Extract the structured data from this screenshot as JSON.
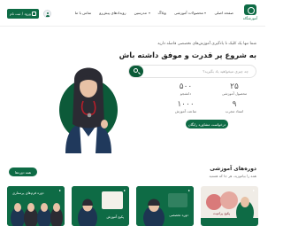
{
  "header": {
    "logo_text": "آموزشگاه",
    "nav": [
      {
        "label": "صفحه اصلی",
        "dropdown": false
      },
      {
        "label": "محصولات آموزشی",
        "dropdown": true
      },
      {
        "label": "وبلاگ",
        "dropdown": false
      },
      {
        "label": "مدرسین",
        "dropdown": true
      },
      {
        "label": "رویدادهای پیش‌رو",
        "dropdown": false
      },
      {
        "label": "تماس با ما",
        "dropdown": false
      }
    ],
    "login_label": "ورود / ثبت نام"
  },
  "hero": {
    "small_text": "شما تنها یک کلیک تا یادگیری آموزش‌های تخصصی فاصله دارید",
    "title": "به شروع پر قدرت و موفق داشته باش",
    "search_placeholder": "چه چیزی میخواهید یاد بگیرید؟",
    "stats": [
      {
        "number": "۲۵",
        "label": "محصول آموزشی"
      },
      {
        "number": "۵۰۰",
        "label": "دانشجو"
      },
      {
        "number": "۹",
        "label": "استاد مجرب"
      },
      {
        "number": "۱۰۰۰",
        "label": "ساعت آموزش"
      }
    ],
    "cta_label": "درخواست مشاوره رایگان"
  },
  "courses": {
    "title": "دوره‌های آموزشی",
    "subtitle": "همه را بیاموزید، هر جا که هستید",
    "see_all": "همه دوره‌ها",
    "cards": [
      {
        "label": "پکیج پرامپت",
        "bg": "#f0ece6"
      },
      {
        "label": "دوره تخصصی",
        "bg": "#0e6b45"
      },
      {
        "label": "پکیج آموزش",
        "bg": "#0e6b45"
      },
      {
        "label": "دوره فرم‌های پرستاری",
        "bg": "#0e6b45"
      }
    ]
  },
  "colors": {
    "brand": "#0e6b45",
    "brand_dark": "#0b5b38"
  }
}
